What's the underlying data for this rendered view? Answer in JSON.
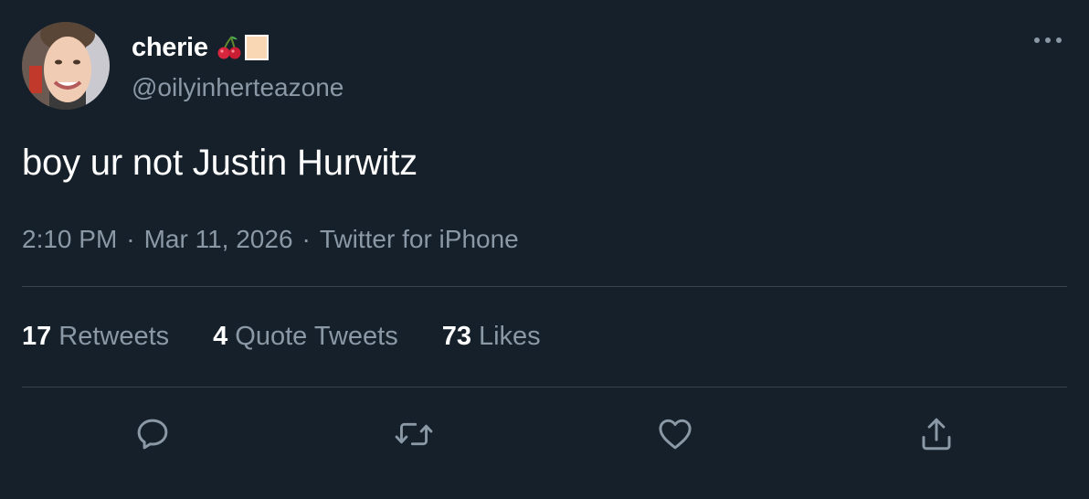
{
  "user": {
    "display_name": "cherie",
    "handle": "@oilyinherteazone",
    "name_emojis": [
      "cherries-emoji",
      "beige-square-emoji"
    ]
  },
  "tweet": {
    "text": "boy ur not Justin Hurwitz",
    "time": "2:10 PM",
    "date": "Mar 11, 2026",
    "source": "Twitter for iPhone",
    "separator": "·"
  },
  "stats": {
    "retweets": {
      "count": "17",
      "label": "Retweets"
    },
    "quotes": {
      "count": "4",
      "label": "Quote Tweets"
    },
    "likes": {
      "count": "73",
      "label": "Likes"
    }
  },
  "colors": {
    "background": "#15202b",
    "primary_text": "#ffffff",
    "secondary_text": "#8b98a5",
    "divider": "#38444d"
  },
  "icons": {
    "more": "more-dots-icon",
    "reply": "reply-icon",
    "retweet": "retweet-icon",
    "like": "heart-icon",
    "share": "share-icon"
  }
}
